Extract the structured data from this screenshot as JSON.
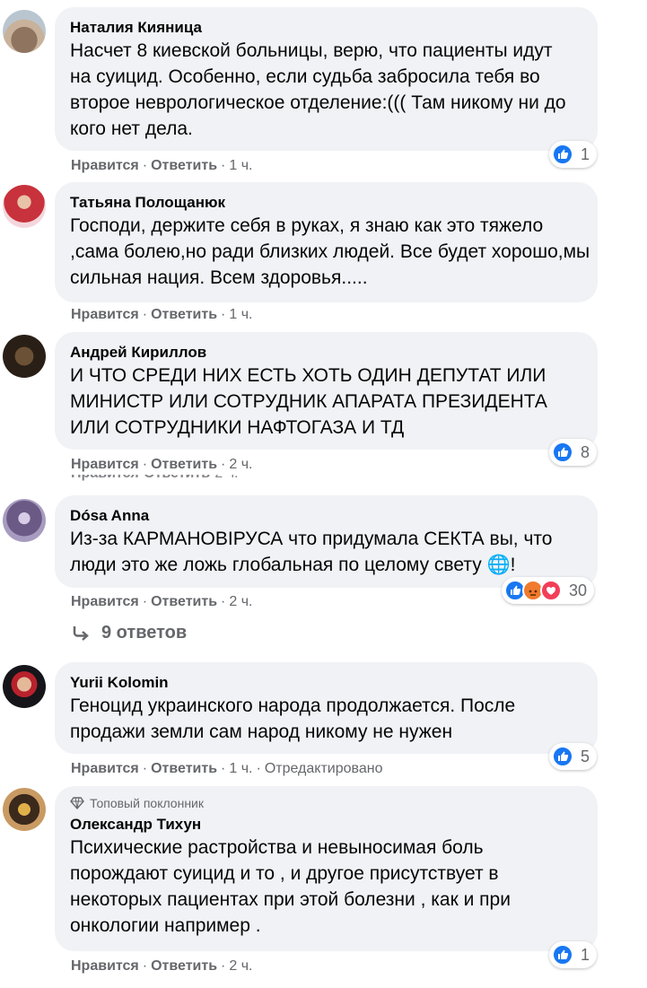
{
  "ui": {
    "like_label": "Нравится",
    "reply_label": "Ответить",
    "dot": "·"
  },
  "comments": [
    {
      "author": "Наталия Кияница",
      "text": "Насчет 8 киевской больницы, верю, что пациенты идут на суицид. Особенно, если судьба забросила тебя во второе неврологическое отделение:((( Там никому ни до кого нет дела.",
      "time": "1 ч.",
      "reaction_count": "1"
    },
    {
      "author": "Татьяна Полощанюк",
      "text": "Господи, держите себя в руках, я знаю как это тяжело ,сама болею,но ради близких людей. Все будет хорошо,мы сильная нация. Всем здоровья.....",
      "time": "1 ч."
    },
    {
      "author": "Андрей Кириллов",
      "text": "И ЧТО СРЕДИ НИХ ЕСТЬ ХОТЬ ОДИН ДЕПУТАТ ИЛИ МИНИСТР ИЛИ СОТРУДНИК АПАРАТА ПРЕЗИДЕНТА ИЛИ СОТРУДНИКИ НАФТОГАЗА И ТД",
      "time": "2 ч.",
      "reaction_count": "8"
    },
    {
      "author": "Dósa Anna",
      "text": "Из-за КАРМАНОВІРУСА что придумала СЕКТА вы, что люди это же ложь глобальная по целому свету 🌐!",
      "time": "2 ч.",
      "reaction_count": "30",
      "replies_label": "9 ответов"
    },
    {
      "author": "Yurii Kolomin",
      "text": "Геноцид украинского народа продолжается. После продажи земли сам народ никому не нужен",
      "time": "1 ч.",
      "edited": "Отредактировано",
      "reaction_count": "5"
    },
    {
      "badge": "Топовый поклонник",
      "author": "Олександр Тихун",
      "text": "Психические растройства и невыносимая боль порождают суицид и то , и другое присутствует в некоторых пациентах при этой болезни , как и при онкологии например .",
      "time": "2 ч.",
      "reaction_count": "1"
    }
  ],
  "colors": {
    "bubble": "#f0f2f5",
    "meta": "#65676b",
    "like_blue": "#1877f2",
    "angry_orange": "#f07a2d",
    "love_red": "#f33e58"
  },
  "icons": [
    "like-icon",
    "angry-icon",
    "love-icon",
    "reply-arrow-icon",
    "diamond-icon",
    "globe-emoji"
  ]
}
